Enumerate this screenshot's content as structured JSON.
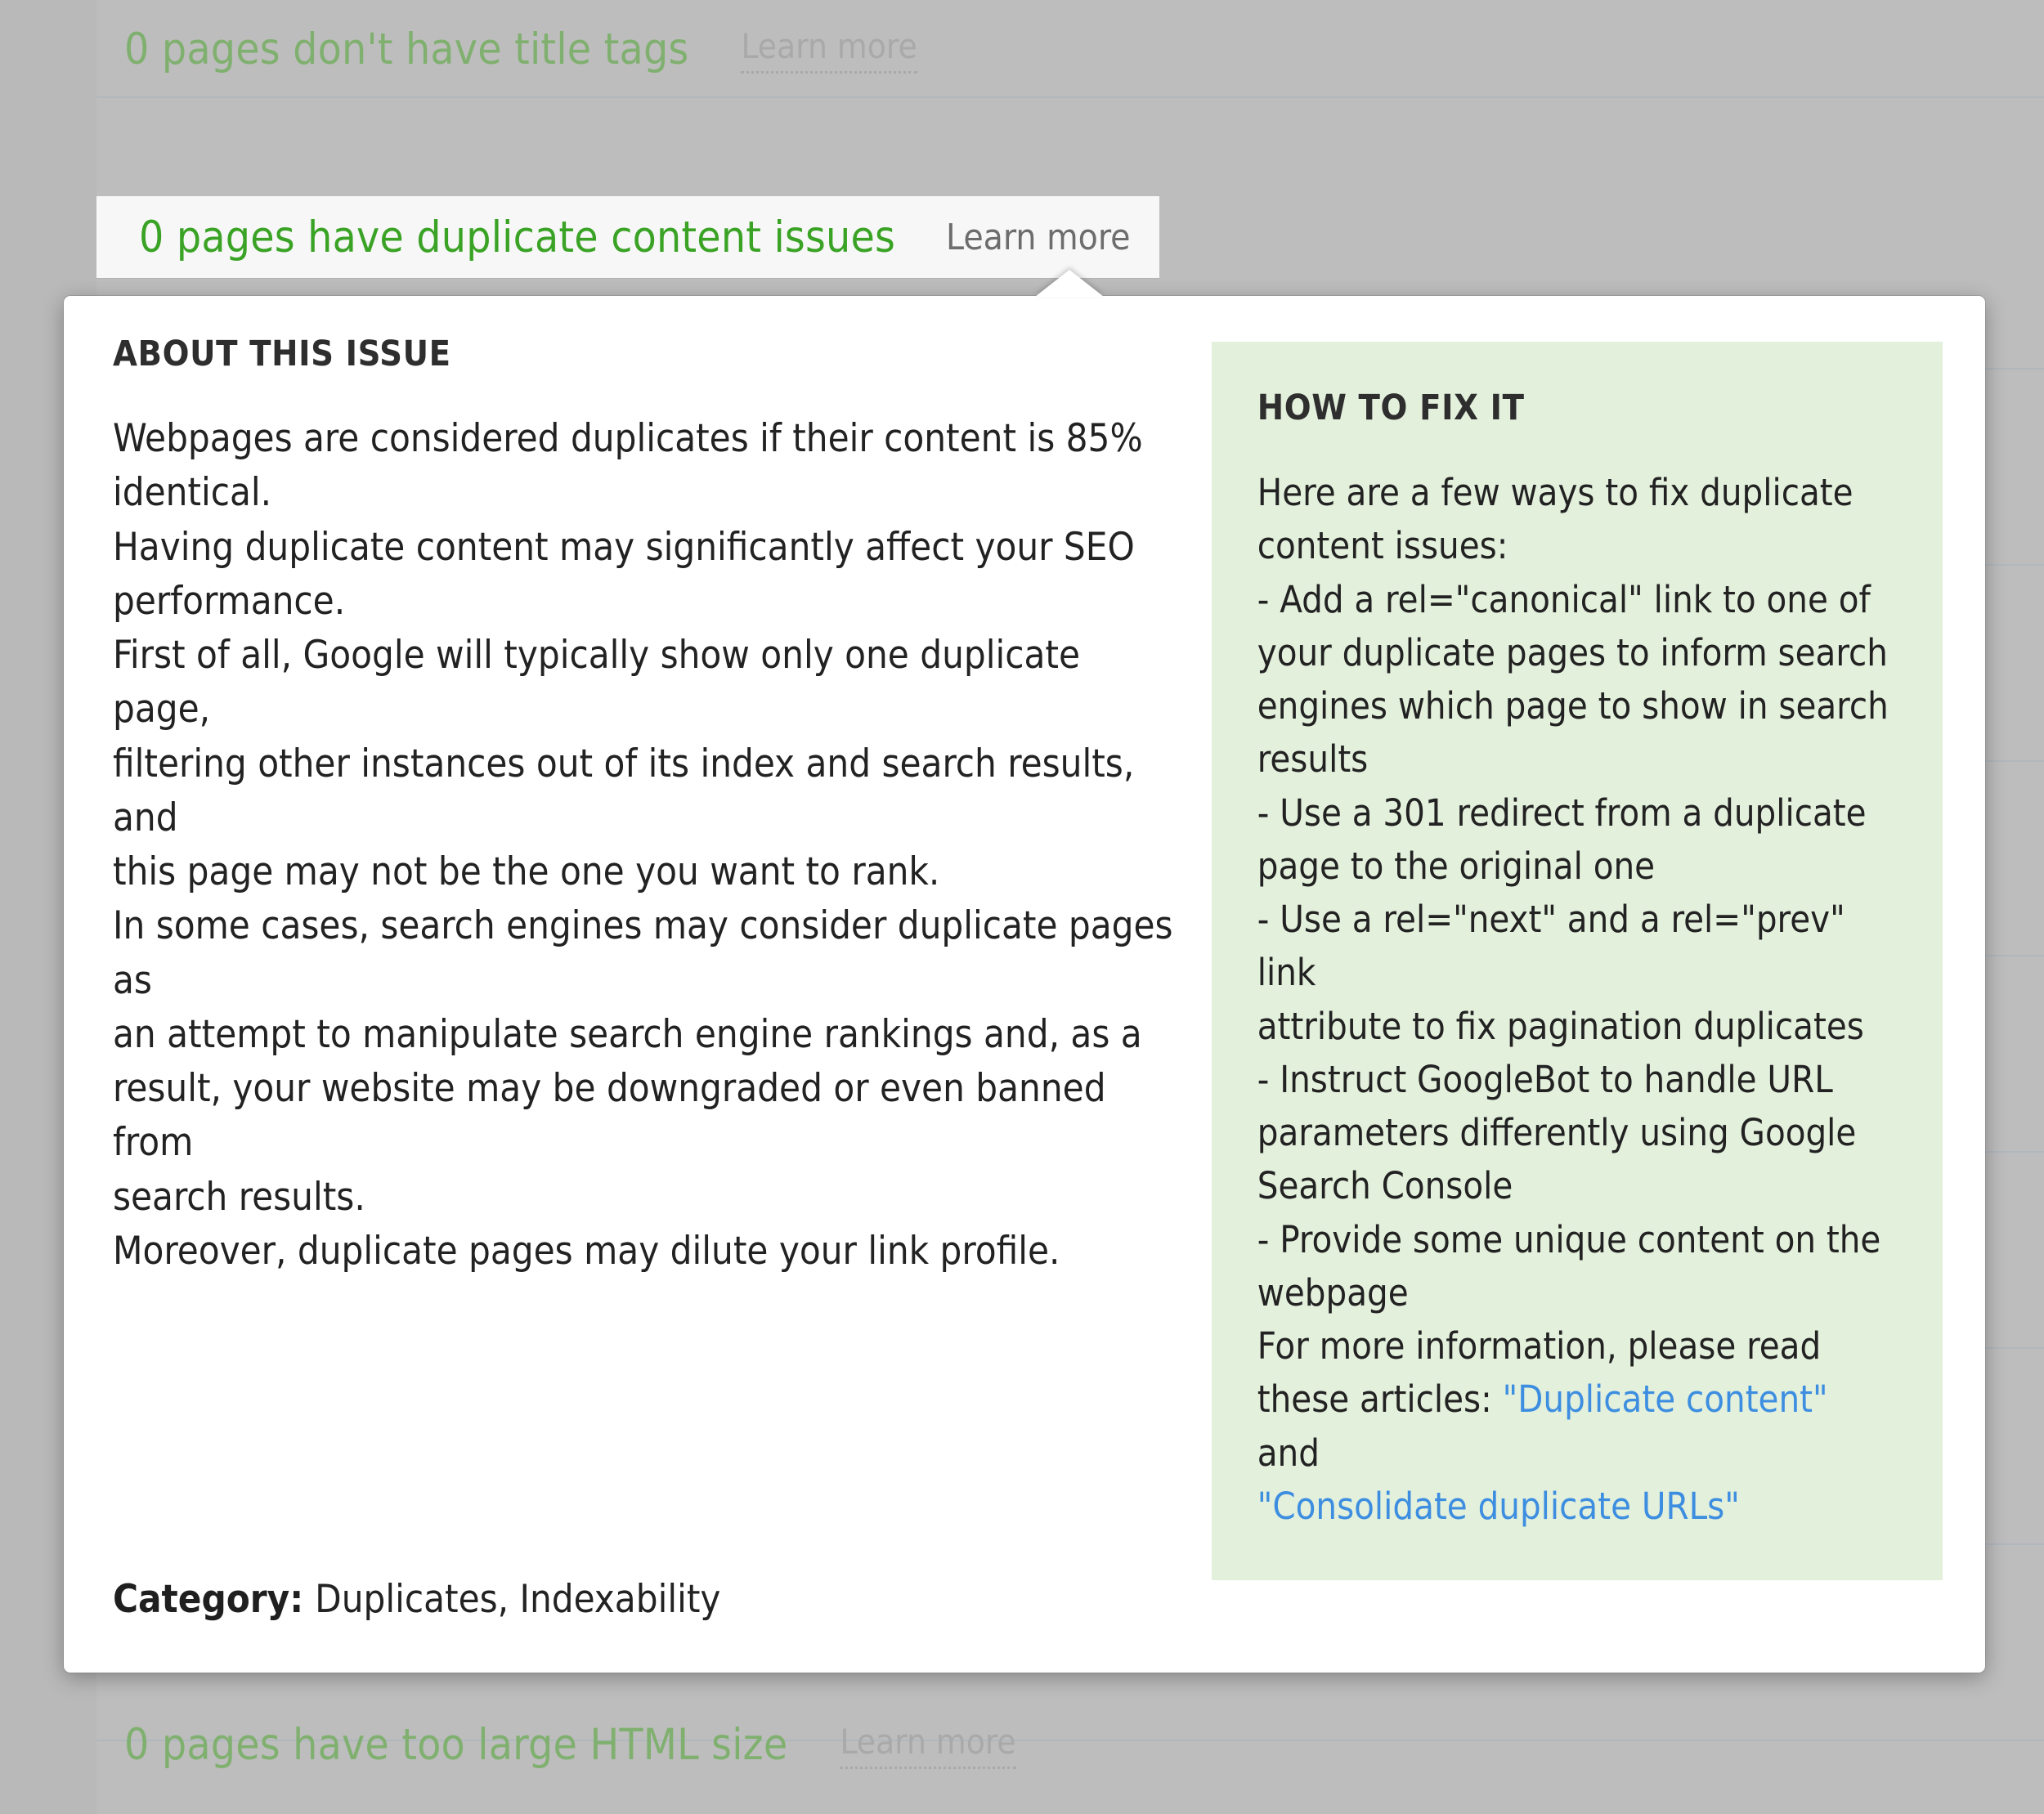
{
  "background": {
    "rows": [
      {
        "label": "0 pages don't have title tags",
        "learn_more": "Learn more"
      },
      {
        "label": "0 pages have too large HTML size",
        "learn_more": "Learn more"
      }
    ]
  },
  "active_row": {
    "label": "0 pages have duplicate content issues",
    "learn_more": "Learn more"
  },
  "popup": {
    "about": {
      "title": "ABOUT THIS ISSUE",
      "lines": [
        "Webpages are considered duplicates if their content is 85%",
        "identical.",
        "Having duplicate content may significantly affect your SEO",
        "performance.",
        "First of all, Google will typically show only one duplicate page,",
        "filtering other instances out of its index and search results, and",
        "this page may not be the one you want to rank.",
        "In some cases, search engines may consider duplicate pages as",
        "an attempt to manipulate search engine rankings and, as a",
        "result, your website may be downgraded or even banned from",
        "search results.",
        "Moreover, duplicate pages may dilute your link profile."
      ]
    },
    "fix": {
      "title": "HOW TO FIX IT",
      "lines": [
        "Here are a few ways to fix duplicate",
        "content issues:",
        "- Add a rel=\"canonical\" link to one of",
        "your duplicate pages to inform search",
        "engines which page to show in search",
        "results",
        "- Use a 301 redirect from a duplicate",
        "page to the original one",
        "- Use a rel=\"next\" and a rel=\"prev\" link",
        "attribute to fix pagination duplicates",
        "- Instruct GoogleBot to handle URL",
        "parameters differently using Google",
        "Search Console",
        "- Provide some unique content on the",
        "webpage",
        "For more information, please read"
      ],
      "articles_prefix": "these articles: ",
      "link1": "\"Duplicate content\"",
      "link_joiner": " and",
      "link2": "\"Consolidate duplicate URLs\""
    },
    "category": {
      "label": "Category:",
      "value": "Duplicates, Indexability"
    }
  },
  "colors": {
    "issue_green": "#3aa325",
    "issue_green_dim": "#80b06f",
    "link_blue": "#3d8ee0",
    "fix_panel_bg": "#e3f0dc",
    "page_bg": "#bdbdbd",
    "popup_bg": "#ffffff",
    "row_highlight_bg": "#f7f7f7"
  }
}
